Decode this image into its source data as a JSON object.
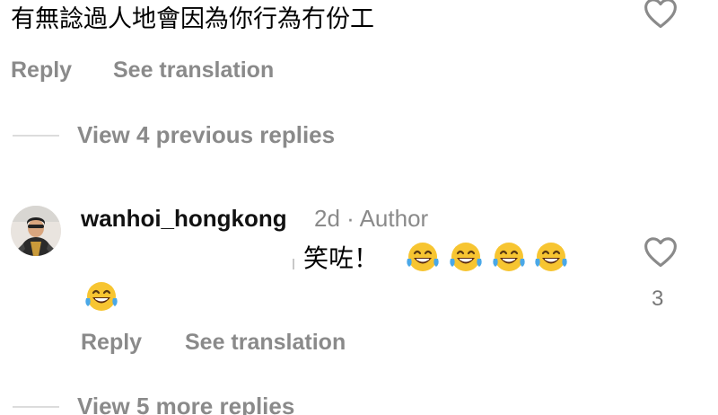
{
  "first_comment": {
    "text": "有無諗過人地會因為你行為冇份工",
    "reply_label": "Reply",
    "translate_label": "See translation"
  },
  "thread": {
    "view_previous_label": "View 4 previous replies",
    "view_more_label": "View 5 more replies"
  },
  "reply_comment": {
    "username": "wanhoi_hongkong",
    "meta": "2d · Author",
    "text": "笑咗！",
    "emojis": [
      "face-with-tears-of-joy",
      "face-with-tears-of-joy",
      "face-with-tears-of-joy",
      "face-with-tears-of-joy",
      "face-with-tears-of-joy"
    ],
    "like_count": "3",
    "reply_label": "Reply",
    "translate_label": "See translation"
  },
  "icons": {
    "like": "heart-outline-icon"
  },
  "colors": {
    "secondary_text": "#8a8a8a",
    "emoji_face": "#f7c531",
    "emoji_tear": "#4aa8e8"
  }
}
